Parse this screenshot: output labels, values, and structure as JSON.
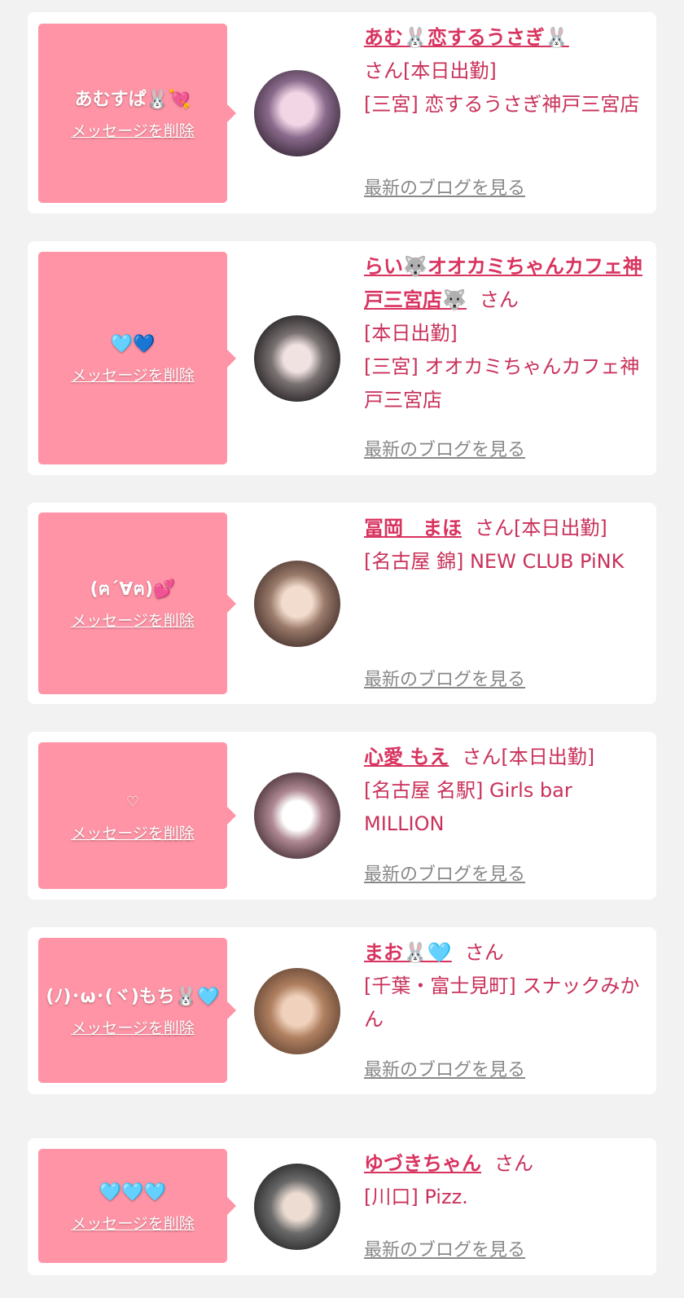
{
  "cards": [
    {
      "message": "あむすぱ🐰💘",
      "delete_label": "メッセージを削除",
      "name": "あむ🐰恋するうさぎ🐰",
      "san": "さん[本日出勤]",
      "shop": "[三宮] 恋するうさぎ神戸三宮店",
      "blog_label": "最新のブログを見る"
    },
    {
      "message": "🩵💙",
      "delete_label": "メッセージを削除",
      "name": "らい🐺オオカミちゃんカフェ神戸三宮店🐺",
      "san": "さん",
      "status": "[本日出勤]",
      "shop": "[三宮] オオカミちゃんカフェ神戸三宮店",
      "blog_label": "最新のブログを見る"
    },
    {
      "message": "(ฅ´∀ฅ)💕",
      "delete_label": "メッセージを削除",
      "name": "冨岡　まほ",
      "san": "さん[本日出勤]",
      "shop": "[名古屋 錦] NEW CLUB PiNK",
      "blog_label": "最新のブログを見る"
    },
    {
      "message": "♡",
      "delete_label": "メッセージを削除",
      "name": "心愛 もえ",
      "san": "さん[本日出勤]",
      "shop": "[名古屋 名駅] Girls bar MILLION",
      "blog_label": "最新のブログを見る"
    },
    {
      "message": "(ﾉ)･ω･(ヾ)もち🐰🩵",
      "delete_label": "メッセージを削除",
      "name": "まお🐰🩵",
      "san": "さん",
      "shop": "[千葉・富士見町] スナックみかん",
      "blog_label": "最新のブログを見る"
    },
    {
      "message": "🩵🩵🩵",
      "delete_label": "メッセージを削除",
      "name": "ゆづきちゃん",
      "san": "さん",
      "shop": "[川口] Pizz.",
      "blog_label": "最新のブログを見る"
    }
  ],
  "colors": {
    "bubble": "#ff94a6",
    "name": "#d8335f",
    "info": "#c9315a",
    "blog": "#888888",
    "background": "#f2f2f2"
  }
}
